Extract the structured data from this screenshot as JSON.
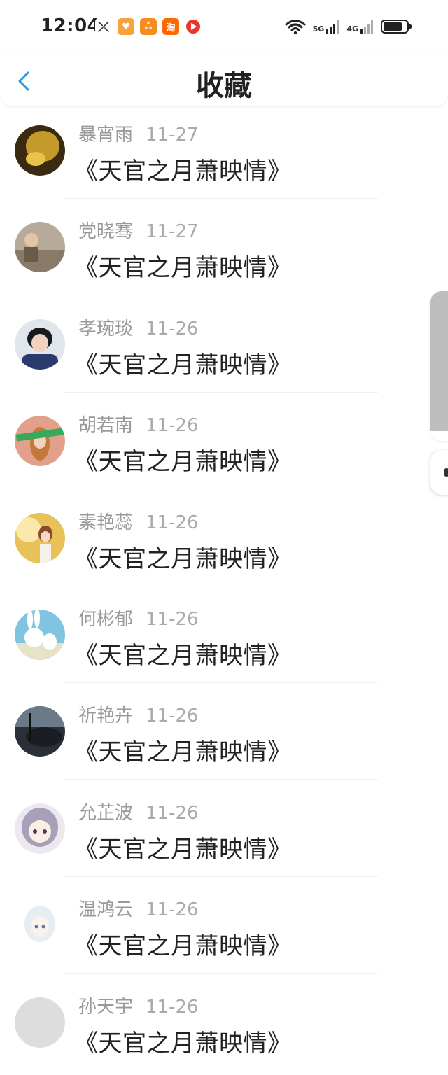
{
  "status_bar": {
    "time": "12:04",
    "app_badges": [
      {
        "name": "missed-call-icon",
        "text": "⤫",
        "color": "#ffffff"
      },
      {
        "name": "heart-app-icon",
        "text": "♥",
        "color": "#f7a23b"
      },
      {
        "name": "app-icon",
        "text": "ஃ",
        "color": "#f58c1f"
      },
      {
        "name": "taobao-icon",
        "text": "淘",
        "color": "#ff6a00"
      },
      {
        "name": "video-app-icon",
        "text": "▶",
        "color": "#e8382c"
      }
    ],
    "network_1": "5G",
    "network_2": "4G"
  },
  "header": {
    "title": "收藏"
  },
  "favorites": [
    {
      "name": "暴宵雨",
      "date": "11-27",
      "title": "《天官之月萧映情》",
      "avatar_color": "#b07a2a"
    },
    {
      "name": "党晓骞",
      "date": "11-27",
      "title": "《天官之月萧映情》",
      "avatar_color": "#9e8a78"
    },
    {
      "name": "孝琬琰",
      "date": "11-26",
      "title": "《天官之月萧映情》",
      "avatar_color": "#3a4a7a"
    },
    {
      "name": "胡若南",
      "date": "11-26",
      "title": "《天官之月萧映情》",
      "avatar_color": "#d08a70"
    },
    {
      "name": "素艳蕊",
      "date": "11-26",
      "title": "《天官之月萧映情》",
      "avatar_color": "#d9b24a"
    },
    {
      "name": "何彬郁",
      "date": "11-26",
      "title": "《天官之月萧映情》",
      "avatar_color": "#7fc4e0"
    },
    {
      "name": "祈艳卉",
      "date": "11-26",
      "title": "《天官之月萧映情》",
      "avatar_color": "#3a4250"
    },
    {
      "name": "允芷波",
      "date": "11-26",
      "title": "《天官之月萧映情》",
      "avatar_color": "#c9c0d0"
    },
    {
      "name": "温鸿云",
      "date": "11-26",
      "title": "《天官之月萧映情》",
      "avatar_color": "#e8eef2"
    },
    {
      "name": "孙天宇",
      "date": "11-26",
      "title": "《天官之月萧映情》",
      "avatar_color": "#dddddd"
    }
  ]
}
